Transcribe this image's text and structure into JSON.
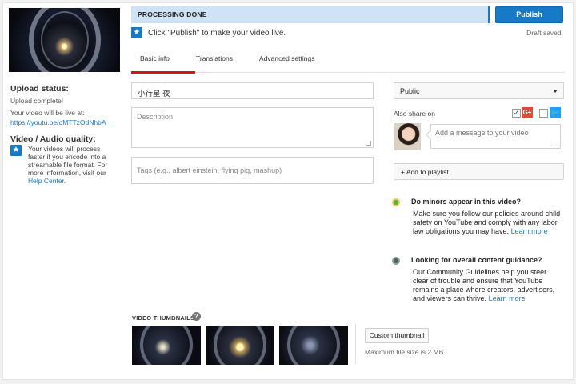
{
  "status_bar": {
    "label": "PROCESSING DONE"
  },
  "publish_button": "Publish",
  "draft_status": "Draft saved.",
  "hint": {
    "icon": "star-icon",
    "text": "Click \"Publish\" to make your video live."
  },
  "tabs": [
    {
      "label": "Basic info",
      "active": true
    },
    {
      "label": "Translations",
      "active": false
    },
    {
      "label": "Advanced settings",
      "active": false
    }
  ],
  "sidebar": {
    "upload_status_title": "Upload status:",
    "upload_status_text": "Upload complete!",
    "live_at_text": "Your video will be live at:",
    "video_link": "https://youtu.be/oMTTzOdNhbA",
    "quality_title": "Video / Audio quality:",
    "quality_text": "Your videos will process faster if you encode into a streamable file format. For more information, visit our",
    "quality_link": "Help Center",
    "quality_end": "."
  },
  "form": {
    "title_value": "小行星 夜",
    "description_placeholder": "Description",
    "tags_placeholder": "Tags (e.g., albert einstein, flying pig, mashup)"
  },
  "privacy": {
    "selected": "Public"
  },
  "share": {
    "label": "Also share on",
    "google_checked": true,
    "twitter_checked": false,
    "message_placeholder": "Add a message to your video"
  },
  "playlist_button": "+ Add to playlist",
  "notices": [
    {
      "title": "Do minors appear in this video?",
      "text": "Make sure you follow our policies around child safety on YouTube and comply with any labor law obligations you may have.",
      "link": "Learn more"
    },
    {
      "title": "Looking for overall content guidance?",
      "text": "Our Community Guidelines help you steer clear of trouble and ensure that YouTube remains a place where creators, advertisers, and viewers can thrive.",
      "link": "Learn more"
    }
  ],
  "thumbnails": {
    "label": "VIDEO THUMBNAILS",
    "custom_button": "Custom thumbnail",
    "max_size": "Maximum file size is 2 MB."
  },
  "colors": {
    "accent": "#167ac6",
    "tab_active": "#cc181e",
    "status_bg": "#cfe2f6"
  }
}
